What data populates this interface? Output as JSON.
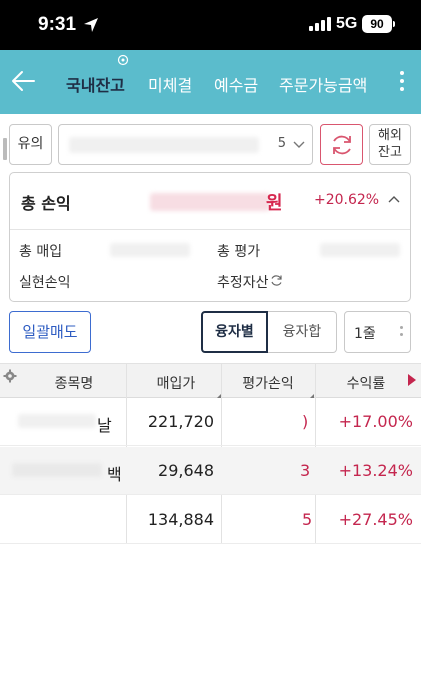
{
  "status_bar": {
    "time": "9:31",
    "network": "5G",
    "battery": "90",
    "icons": [
      "location-arrow-icon",
      "signal-icon"
    ]
  },
  "header": {
    "tabs": [
      {
        "label": "국내잔고",
        "active": true
      },
      {
        "label": "미체결",
        "active": false
      },
      {
        "label": "예수금",
        "active": false
      },
      {
        "label": "주문가능금액",
        "active": false
      }
    ],
    "icons": [
      "back-arrow-icon",
      "more-vertical-icon"
    ]
  },
  "account_bar": {
    "type_label": "유의",
    "account_fragment": "5",
    "overseas_label_line1": "해외",
    "overseas_label_line2": "잔고",
    "icons": [
      "refresh-icon",
      "chevron-down-icon"
    ]
  },
  "summary": {
    "title": "총 손익",
    "amount_visible": "원",
    "rate": "+20.62%",
    "purchase_label": "총 매입",
    "evaluation_label": "총 평가",
    "realized_label": "실현손익",
    "estimated_label": "추정자산",
    "icons": [
      "chevron-up-icon",
      "refresh-small-icon"
    ]
  },
  "controls": {
    "bulk_sell": "일괄매도",
    "segment_options": [
      {
        "label": "융자별",
        "active": true
      },
      {
        "label": "융자합",
        "active": false
      }
    ],
    "lines_label": "1줄"
  },
  "table": {
    "columns": [
      "종목명",
      "매입가",
      "평가손익",
      "수익률"
    ],
    "rows": [
      {
        "name_fragment": "날",
        "purchase_price": "221,720",
        "pl_fragment": ")",
        "return_rate": "+17.00%"
      },
      {
        "name_fragment": "백",
        "purchase_price": "29,648",
        "pl_fragment": "3",
        "return_rate": "+13.24%"
      },
      {
        "name_fragment": "",
        "purchase_price": "134,884",
        "pl_fragment": "5",
        "return_rate": "+27.45%"
      }
    ]
  },
  "colors": {
    "header_bg": "#5bbccc",
    "active_tab": "#1f2e45",
    "profit_red": "#c4264e",
    "bulk_blue": "#2e5cc2"
  }
}
